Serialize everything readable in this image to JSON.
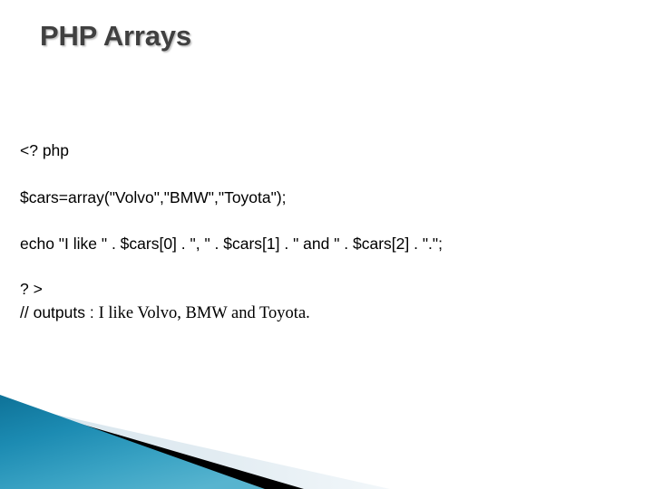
{
  "slide": {
    "title": "PHP Arrays",
    "title_color": "#404040",
    "background_color": "#ffffff"
  },
  "code": {
    "open_tag": "<? php",
    "array_line": "$cars=array(\"Volvo\",\"BMW\",\"Toyota\");",
    "echo_line": "echo \"I like \" . $cars[0] . \", \" . $cars[1] . \" and \" . $cars[2] . \".\";",
    "close_tag": "? >",
    "comment_prefix": "// outputs : ",
    "comment_output": "I like Volvo, BMW and Toyota."
  },
  "decoration": {
    "teal_dark": "#10789E",
    "teal_mid": "#2094BC",
    "teal_light": "#49A9C8",
    "black": "#000000",
    "pale_blue": "#DCE8EF",
    "pale_blue_light": "#EDF3F7"
  }
}
